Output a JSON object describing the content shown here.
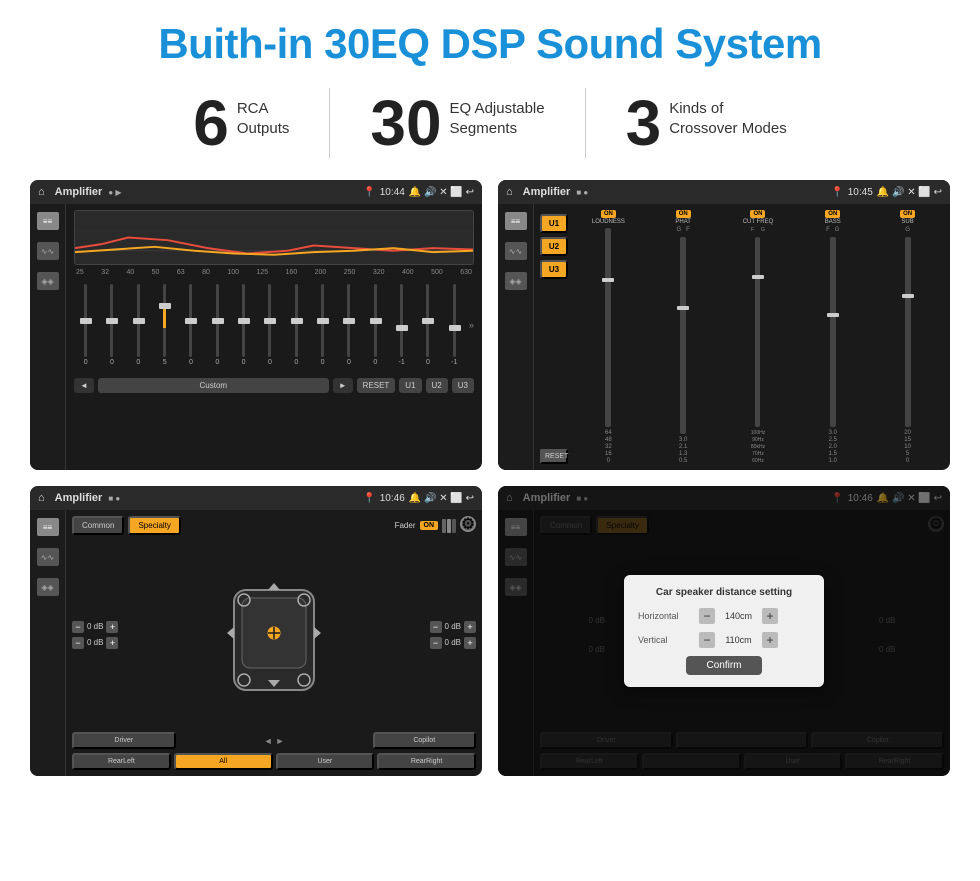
{
  "header": {
    "title": "Buith-in 30EQ DSP Sound System"
  },
  "stats": [
    {
      "number": "6",
      "text_line1": "RCA",
      "text_line2": "Outputs"
    },
    {
      "number": "30",
      "text_line1": "EQ Adjustable",
      "text_line2": "Segments"
    },
    {
      "number": "3",
      "text_line1": "Kinds of",
      "text_line2": "Crossover Modes"
    }
  ],
  "screens": {
    "top_left": {
      "topbar": {
        "title": "Amplifier",
        "time": "10:44",
        "icons": "📍 🔔 🔊 ✕ ⬜ ↩"
      },
      "freq_labels": [
        "25",
        "32",
        "40",
        "50",
        "63",
        "80",
        "100",
        "125",
        "160",
        "200",
        "250",
        "320",
        "400",
        "500",
        "630"
      ],
      "slider_values": [
        "0",
        "0",
        "0",
        "5",
        "0",
        "0",
        "0",
        "0",
        "0",
        "0",
        "0",
        "0",
        "-1",
        "0",
        "-1"
      ],
      "preset_label": "Custom",
      "buttons": [
        "◄",
        "Custom",
        "►",
        "RESET",
        "U1",
        "U2",
        "U3"
      ]
    },
    "top_right": {
      "topbar": {
        "title": "Amplifier",
        "time": "10:45"
      },
      "presets": [
        "U1",
        "U2",
        "U3"
      ],
      "channels": [
        {
          "on": true,
          "name": "LOUDNESS",
          "value": ""
        },
        {
          "on": true,
          "name": "PHAT",
          "value": ""
        },
        {
          "on": true,
          "name": "CUT FREQ",
          "value": ""
        },
        {
          "on": true,
          "name": "BASS",
          "value": ""
        },
        {
          "on": true,
          "name": "SUB",
          "value": ""
        }
      ],
      "reset_label": "RESET"
    },
    "bottom_left": {
      "topbar": {
        "title": "Amplifier",
        "time": "10:46"
      },
      "tabs": [
        "Common",
        "Specialty"
      ],
      "active_tab": "Specialty",
      "fader_label": "Fader",
      "fader_on": "ON",
      "db_values": [
        "0 dB",
        "0 dB",
        "0 dB",
        "0 dB"
      ],
      "buttons": [
        "Driver",
        "",
        "Copilot",
        "RearLeft",
        "All",
        "User",
        "RearRight"
      ]
    },
    "bottom_right": {
      "topbar": {
        "title": "Amplifier",
        "time": "10:46"
      },
      "tabs": [
        "Common",
        "Specialty"
      ],
      "dialog": {
        "title": "Car speaker distance setting",
        "horizontal_label": "Horizontal",
        "horizontal_value": "140cm",
        "vertical_label": "Vertical",
        "vertical_value": "110cm",
        "confirm_label": "Confirm"
      },
      "db_values": [
        "0 dB",
        "0 dB"
      ],
      "buttons": [
        "Driver",
        "",
        "Copilot",
        "RearLeft",
        "",
        "User",
        "RearRight"
      ]
    }
  }
}
